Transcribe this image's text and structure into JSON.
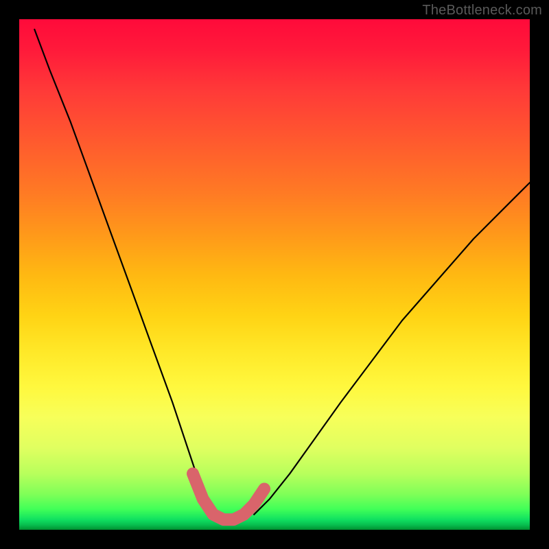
{
  "watermark": "TheBottleneck.com",
  "chart_data": {
    "type": "line",
    "title": "",
    "xlabel": "",
    "ylabel": "",
    "xlim": [
      0,
      100
    ],
    "ylim": [
      0,
      100
    ],
    "grid": false,
    "legend": false,
    "notes": "Bottleneck-percentage-style chart: horizontal axis is component ratio (unlabeled), vertical axis is bottleneck severity (unlabeled). Background gradient encodes severity (red=high, green=low). Two convex black curves descend from opposite sides to a flat minimum near x≈38–46; minimum segment is overdrawn with a thick salmon highlight.",
    "series": [
      {
        "name": "left-arm",
        "color": "#000000",
        "x": [
          3,
          6,
          10,
          14,
          18,
          22,
          26,
          30,
          33,
          35,
          37,
          38
        ],
        "y": [
          98,
          90,
          80,
          69,
          58,
          47,
          36,
          25,
          16,
          10,
          5,
          3
        ]
      },
      {
        "name": "right-arm",
        "color": "#000000",
        "x": [
          46,
          49,
          53,
          58,
          63,
          69,
          75,
          82,
          89,
          96,
          100
        ],
        "y": [
          3,
          6,
          11,
          18,
          25,
          33,
          41,
          49,
          57,
          64,
          68
        ]
      },
      {
        "name": "highlight-min",
        "color": "#d9646b",
        "stroke_width": 18,
        "x": [
          34,
          36,
          38,
          40,
          42,
          44,
          46,
          48
        ],
        "y": [
          11,
          6,
          3,
          2,
          2,
          3,
          5,
          8
        ]
      }
    ]
  },
  "colors": {
    "highlight": "#d9646b",
    "curve": "#000000",
    "frame": "#000000"
  }
}
